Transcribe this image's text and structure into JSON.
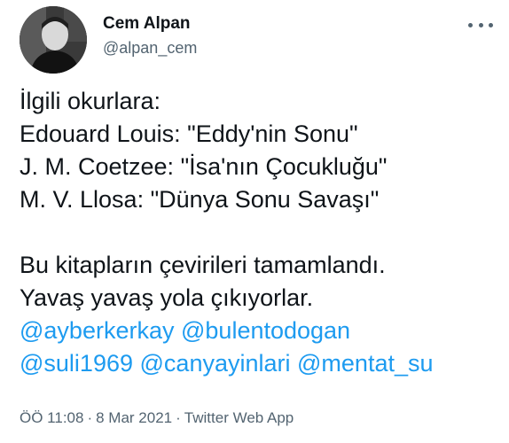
{
  "author": {
    "name": "Cem Alpan",
    "handle": "@alpan_cem"
  },
  "tweet": {
    "lines": [
      "İlgili okurlara:",
      "Edouard Louis: \"Eddy'nin Sonu\"",
      "J. M. Coetzee: \"İsa'nın Çocukluğu\"",
      "M. V. Llosa: \"Dünya Sonu Savaşı\"",
      "",
      "Bu kitapların çevirileri tamamlandı.",
      "Yavaş yavaş yola çıkıyorlar."
    ],
    "mentions": [
      "@ayberkerkay",
      "@bulentodogan",
      "@suli1969",
      "@canyayinlari",
      "@mentat_su"
    ]
  },
  "meta": {
    "time": "ÖÖ 11:08",
    "date": "8 Mar 2021",
    "source": "Twitter Web App",
    "separator": "·"
  },
  "colors": {
    "text": "#0f1419",
    "secondary": "#536471",
    "link": "#1d9bf0"
  }
}
